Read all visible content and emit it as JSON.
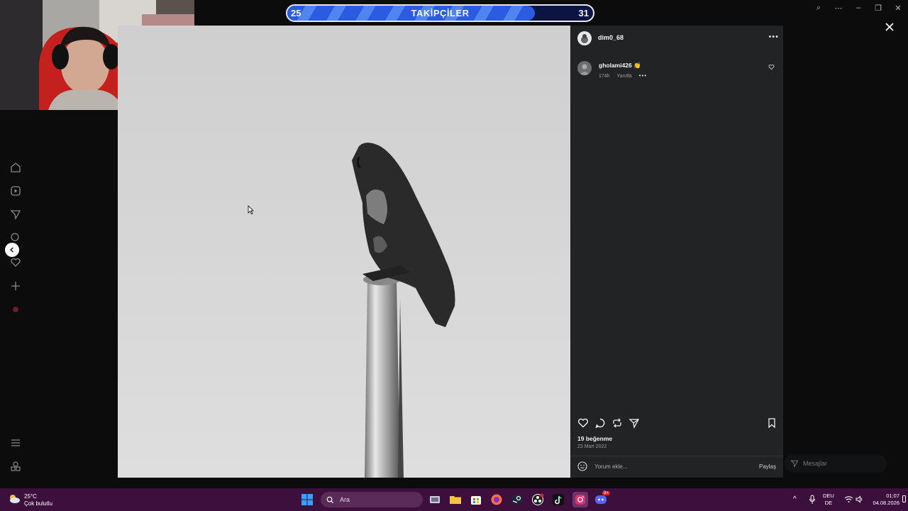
{
  "follower_bar": {
    "current": "25",
    "label": "TAKİPÇİLER",
    "goal": "31",
    "progress": 0.81
  },
  "post": {
    "author": "dim0_68",
    "comment": {
      "user": "gholami426",
      "emoji": "👏",
      "age": "174h",
      "reply": "Yanıtla"
    },
    "likes": "19 beğenme",
    "date": "23 Mart 2022",
    "comment_placeholder": "Yorum ekle...",
    "share_label": "Paylaş"
  },
  "messages_label": "Mesajlar",
  "taskbar": {
    "weather_temp": "25°C",
    "weather_desc": "Çok bulutlu",
    "search_label": "Ara",
    "lang_top": "DEU",
    "lang_bottom": "DE",
    "time": "01:07",
    "date": "04.08.2026",
    "discord_badge": "9+"
  },
  "icons": {
    "nav": [
      "home-icon",
      "reels-icon",
      "send-icon",
      "search-icon",
      "heart-icon",
      "plus-icon",
      "profile-icon",
      "menu-icon",
      "apps-icon"
    ],
    "actions": [
      "like-icon",
      "comment-icon",
      "repost-icon",
      "share-icon",
      "bookmark-icon"
    ],
    "taskbar_apps": [
      "windows-start-icon",
      "task-view-icon",
      "file-explorer-icon",
      "store-icon",
      "firefox-icon",
      "steam-icon",
      "obs-icon",
      "tiktok-icon",
      "instagram-icon",
      "discord-icon"
    ]
  },
  "colors": {
    "taskbar": "#3d0f3d",
    "panel": "#212325",
    "bar_fill": "#2a5be0",
    "instagram_active": "#e1306c"
  }
}
